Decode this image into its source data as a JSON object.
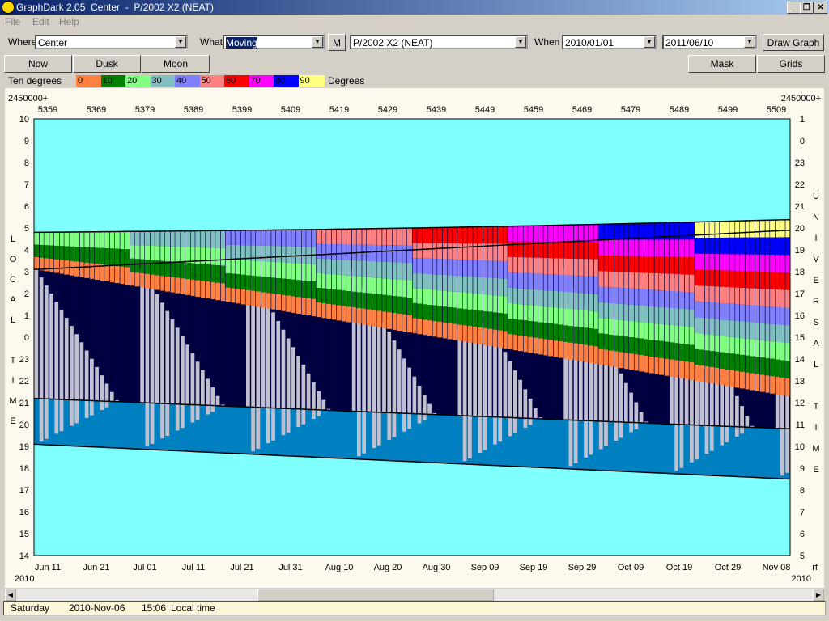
{
  "window": {
    "title": "GraphDark 2.05  Center  -  P/2002 X2 (NEAT)"
  },
  "menu": [
    "File",
    "Edit",
    "Help"
  ],
  "toolbar": {
    "where_label": "Where",
    "where_value": "Center",
    "what_label": "What",
    "what_value": "Moving",
    "m_button": "M",
    "object_value": "P/2002 X2 (NEAT)",
    "when_label": "When",
    "date_from": "2010/01/01",
    "date_to": "2011/06/10",
    "draw_button": "Draw Graph"
  },
  "toolbar2": {
    "now": "Now",
    "dusk": "Dusk",
    "moon": "Moon",
    "mask": "Mask",
    "grids": "Grids"
  },
  "legend": {
    "label": "Ten degrees",
    "units": "Degrees",
    "items": [
      {
        "text": "0",
        "color": "#ff8040"
      },
      {
        "text": "10",
        "color": "#008000"
      },
      {
        "text": "20",
        "color": "#80ff80"
      },
      {
        "text": "30",
        "color": "#80c0c0"
      },
      {
        "text": "40",
        "color": "#8080ff"
      },
      {
        "text": "50",
        "color": "#ff8080"
      },
      {
        "text": "60",
        "color": "#ff0000"
      },
      {
        "text": "70",
        "color": "#ff00ff"
      },
      {
        "text": "80",
        "color": "#0000ff"
      },
      {
        "text": "90",
        "color": "#ffff80"
      }
    ]
  },
  "chart_data": {
    "type": "heatmap",
    "top_axis": {
      "prefix_left": "2450000+",
      "prefix_right": "2450000+",
      "ticks": [
        "5359",
        "5369",
        "5379",
        "5389",
        "5399",
        "5409",
        "5419",
        "5429",
        "5439",
        "5449",
        "5459",
        "5469",
        "5479",
        "5489",
        "5499",
        "5509"
      ]
    },
    "bottom_axis": {
      "year_left": "2010",
      "year_right": "2010",
      "right_label": "rf",
      "ticks": [
        "Jun 11",
        "Jun 21",
        "Jul 01",
        "Jul 11",
        "Jul 21",
        "Jul 31",
        "Aug 10",
        "Aug 20",
        "Aug 30",
        "Sep 09",
        "Sep 19",
        "Sep 29",
        "Oct 09",
        "Oct 19",
        "Oct 29",
        "Nov 08"
      ]
    },
    "left_axis": {
      "title": "LOCAL TIME",
      "ticks": [
        "10",
        "9",
        "8",
        "7",
        "6",
        "5",
        "4",
        "3",
        "2",
        "1",
        "0",
        "23",
        "22",
        "21",
        "20",
        "19",
        "18",
        "17",
        "16",
        "15",
        "14"
      ]
    },
    "right_axis": {
      "title_top": "UNIVERSAL",
      "title_bottom": "TIME",
      "ticks": [
        "1",
        "0",
        "23",
        "22",
        "21",
        "20",
        "19",
        "18",
        "17",
        "16",
        "15",
        "14",
        "13",
        "12",
        "11",
        "10",
        "9",
        "8",
        "7",
        "6",
        "5"
      ]
    },
    "colors": {
      "sky": "#80ffff",
      "twilight": "#0080c0",
      "night": "#000040",
      "moon": "#c0c0d0"
    }
  },
  "status": {
    "day": "Saturday",
    "date": "2010-Nov-06",
    "time": "15:06",
    "zone": "Local time"
  }
}
